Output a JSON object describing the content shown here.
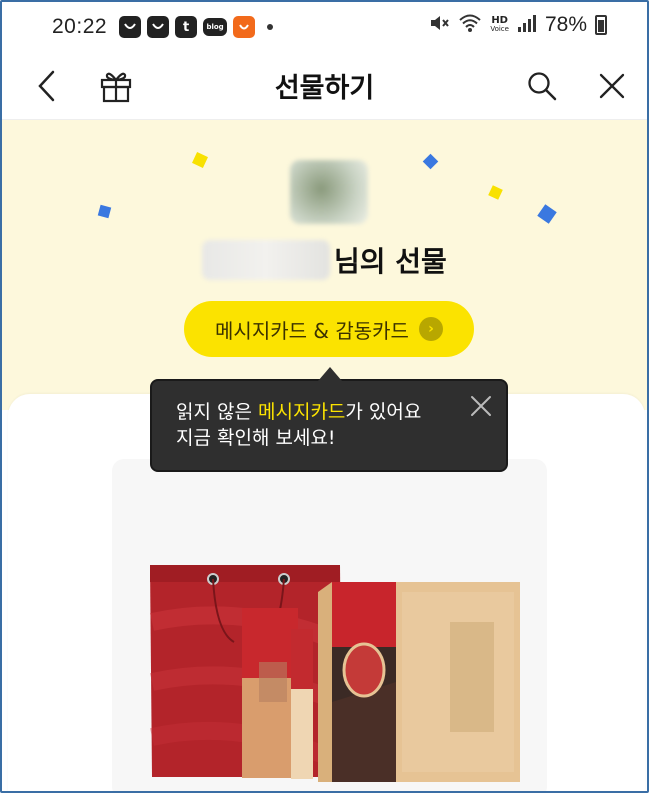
{
  "status_bar": {
    "time": "20:22",
    "notification_icons": [
      "shopping-bag-icon",
      "shopping-bag-icon",
      "tistory-t-icon",
      "blog-bubble-icon",
      "aliexpress-icon"
    ],
    "tistory_glyph": "t",
    "blog_glyph": "blog",
    "hd_label": "HD",
    "voice_label": "Voice",
    "battery": "78%"
  },
  "app_bar": {
    "title": "선물하기"
  },
  "gift": {
    "sender_suffix": "님의 선물",
    "card_button_label": "메시지카드 & 감동카드",
    "card_button_arrow": "›"
  },
  "tooltip": {
    "line1_before": "읽지 않은 ",
    "line1_highlight": "메시지카드",
    "line1_after": "가 있어요",
    "line2": "지금 확인해 보세요!"
  },
  "colors": {
    "accent_yellow": "#fbe300",
    "hero_bg": "#fdf8dc",
    "tooltip_bg": "#2f2f2f",
    "confetti_blue": "#3a78e0"
  }
}
